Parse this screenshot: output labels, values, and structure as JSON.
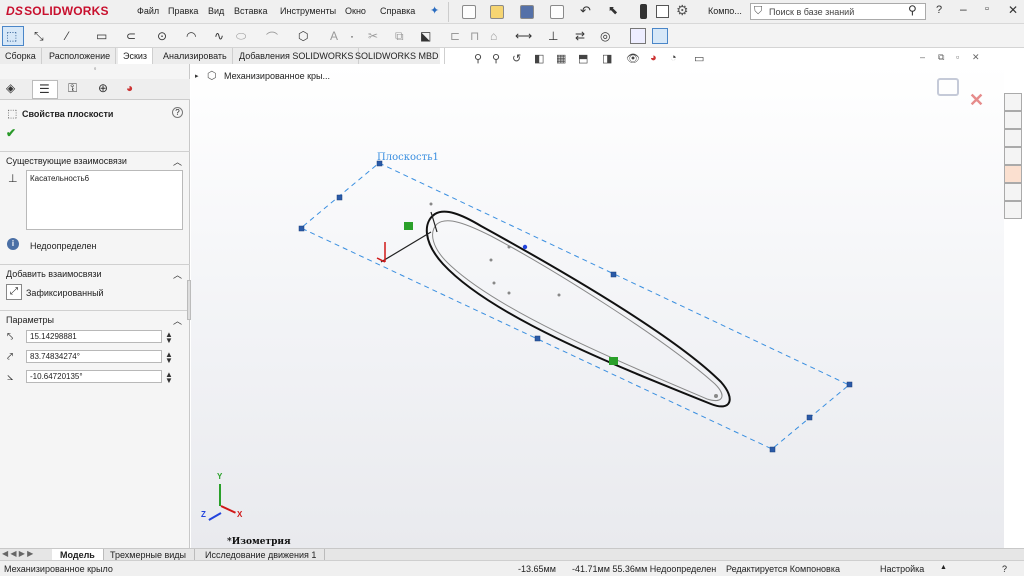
{
  "app": {
    "logo_ds": "DS",
    "logo_text": "SOLIDWORKS"
  },
  "menu": [
    "Файл",
    "Правка",
    "Вид",
    "Вставка",
    "Инструменты",
    "Окно",
    "Справка"
  ],
  "title_short": "Компо...",
  "search": {
    "placeholder": "Поиск в базе знаний"
  },
  "command_tabs": [
    "Сборка",
    "Расположение",
    "Эскиз",
    "Анализировать",
    "Добавления SOLIDWORKS",
    "SOLIDWORKS MBD"
  ],
  "active_tab": "Эскиз",
  "tree": {
    "item": "Механизированное кры..."
  },
  "panel": {
    "title": "Свойства плоскости",
    "existing_relations": {
      "header": "Существующие взаимосвязи",
      "items": [
        "Касательность6"
      ]
    },
    "status": "Недоопределен",
    "add_relations": {
      "header": "Добавить взаимосвязи",
      "items": [
        "Зафиксированный"
      ]
    },
    "parameters": {
      "header": "Параметры",
      "values": [
        "15.14298881",
        "83.74834274°",
        "-10.64720135°"
      ]
    }
  },
  "viewport": {
    "plane_label": "Плоскость1",
    "view_name": "*Изометрия",
    "triad": {
      "x": "X",
      "y": "Y",
      "z": "Z"
    }
  },
  "bottom_tabs": [
    "Модель",
    "Трехмерные виды",
    "Исследование движения 1"
  ],
  "status": {
    "doc": "Механизированное крыло",
    "x": "-13.65мм",
    "yz": "-41.71мм 55.36мм Недоопределен",
    "mode": "Редактируется Компоновка",
    "settings": "Настройка"
  },
  "colors": {
    "accent": "#c8102e",
    "plane": "#3a8fe0",
    "handle": "#2255aa"
  }
}
